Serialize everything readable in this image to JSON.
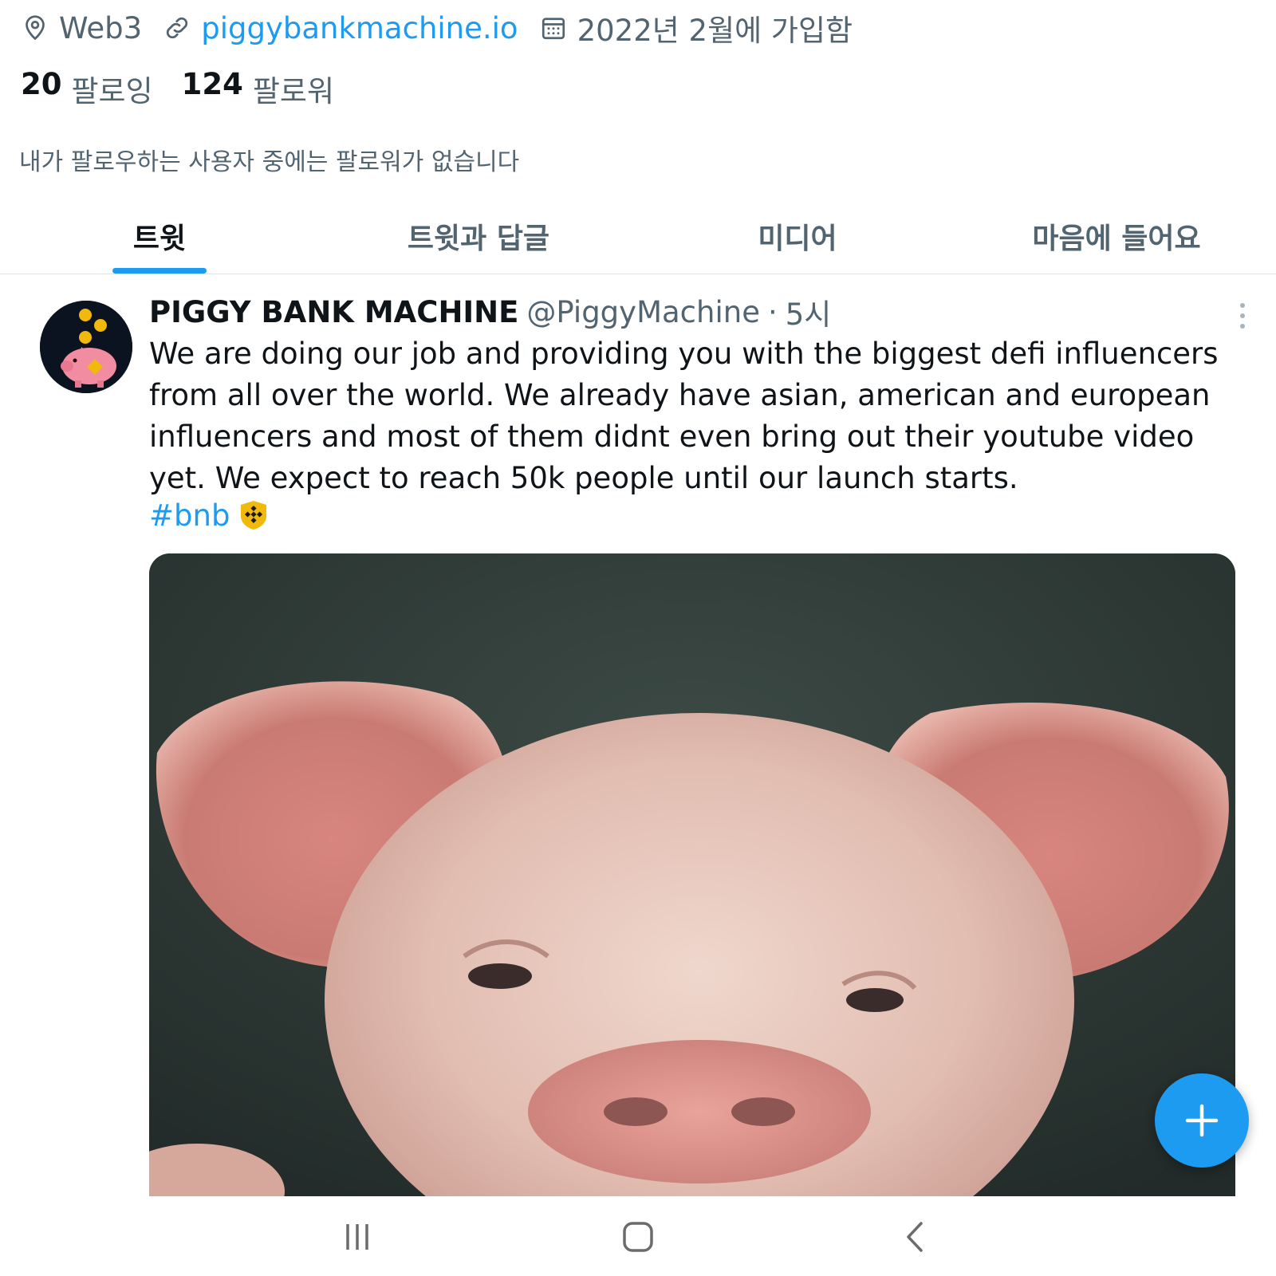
{
  "profile": {
    "location": "Web3",
    "website": "piggybankmachine.io",
    "joined": "2022년 2월에 가입함",
    "following_count": "20",
    "following_label": "팔로잉",
    "followers_count": "124",
    "followers_label": "팔로워",
    "no_followers_you_know": "내가 팔로우하는 사용자 중에는 팔로워가 없습니다"
  },
  "tabs": [
    {
      "label": "트윗",
      "active": true
    },
    {
      "label": "트윗과 답글",
      "active": false
    },
    {
      "label": "미디어",
      "active": false
    },
    {
      "label": "마음에 들어요",
      "active": false
    }
  ],
  "tweet": {
    "author_name": "PIGGY BANK MACHINE",
    "handle": "@PiggyMachine",
    "separator": "·",
    "time": "5시",
    "text": "We are doing our job and providing you with the biggest defi influencers from all over the world. We already have asian, american and european influencers and most of them didnt even bring out their youtube video yet. We expect to reach 50k people until our launch starts.",
    "hashtag": "#bnb",
    "hashtag_icon": "bnb-icon",
    "media_subject": "pig-photo"
  },
  "icons": {
    "location": "location-pin-icon",
    "link": "link-icon",
    "calendar": "calendar-icon",
    "more": "more-vertical-icon",
    "compose": "plus-icon",
    "nav_recents": "recents-icon",
    "nav_home": "home-icon",
    "nav_back": "back-icon"
  },
  "colors": {
    "accent": "#1d9bf0",
    "text_primary": "#0f1419",
    "text_secondary": "#536471",
    "bnb_yellow": "#f0b90b"
  }
}
